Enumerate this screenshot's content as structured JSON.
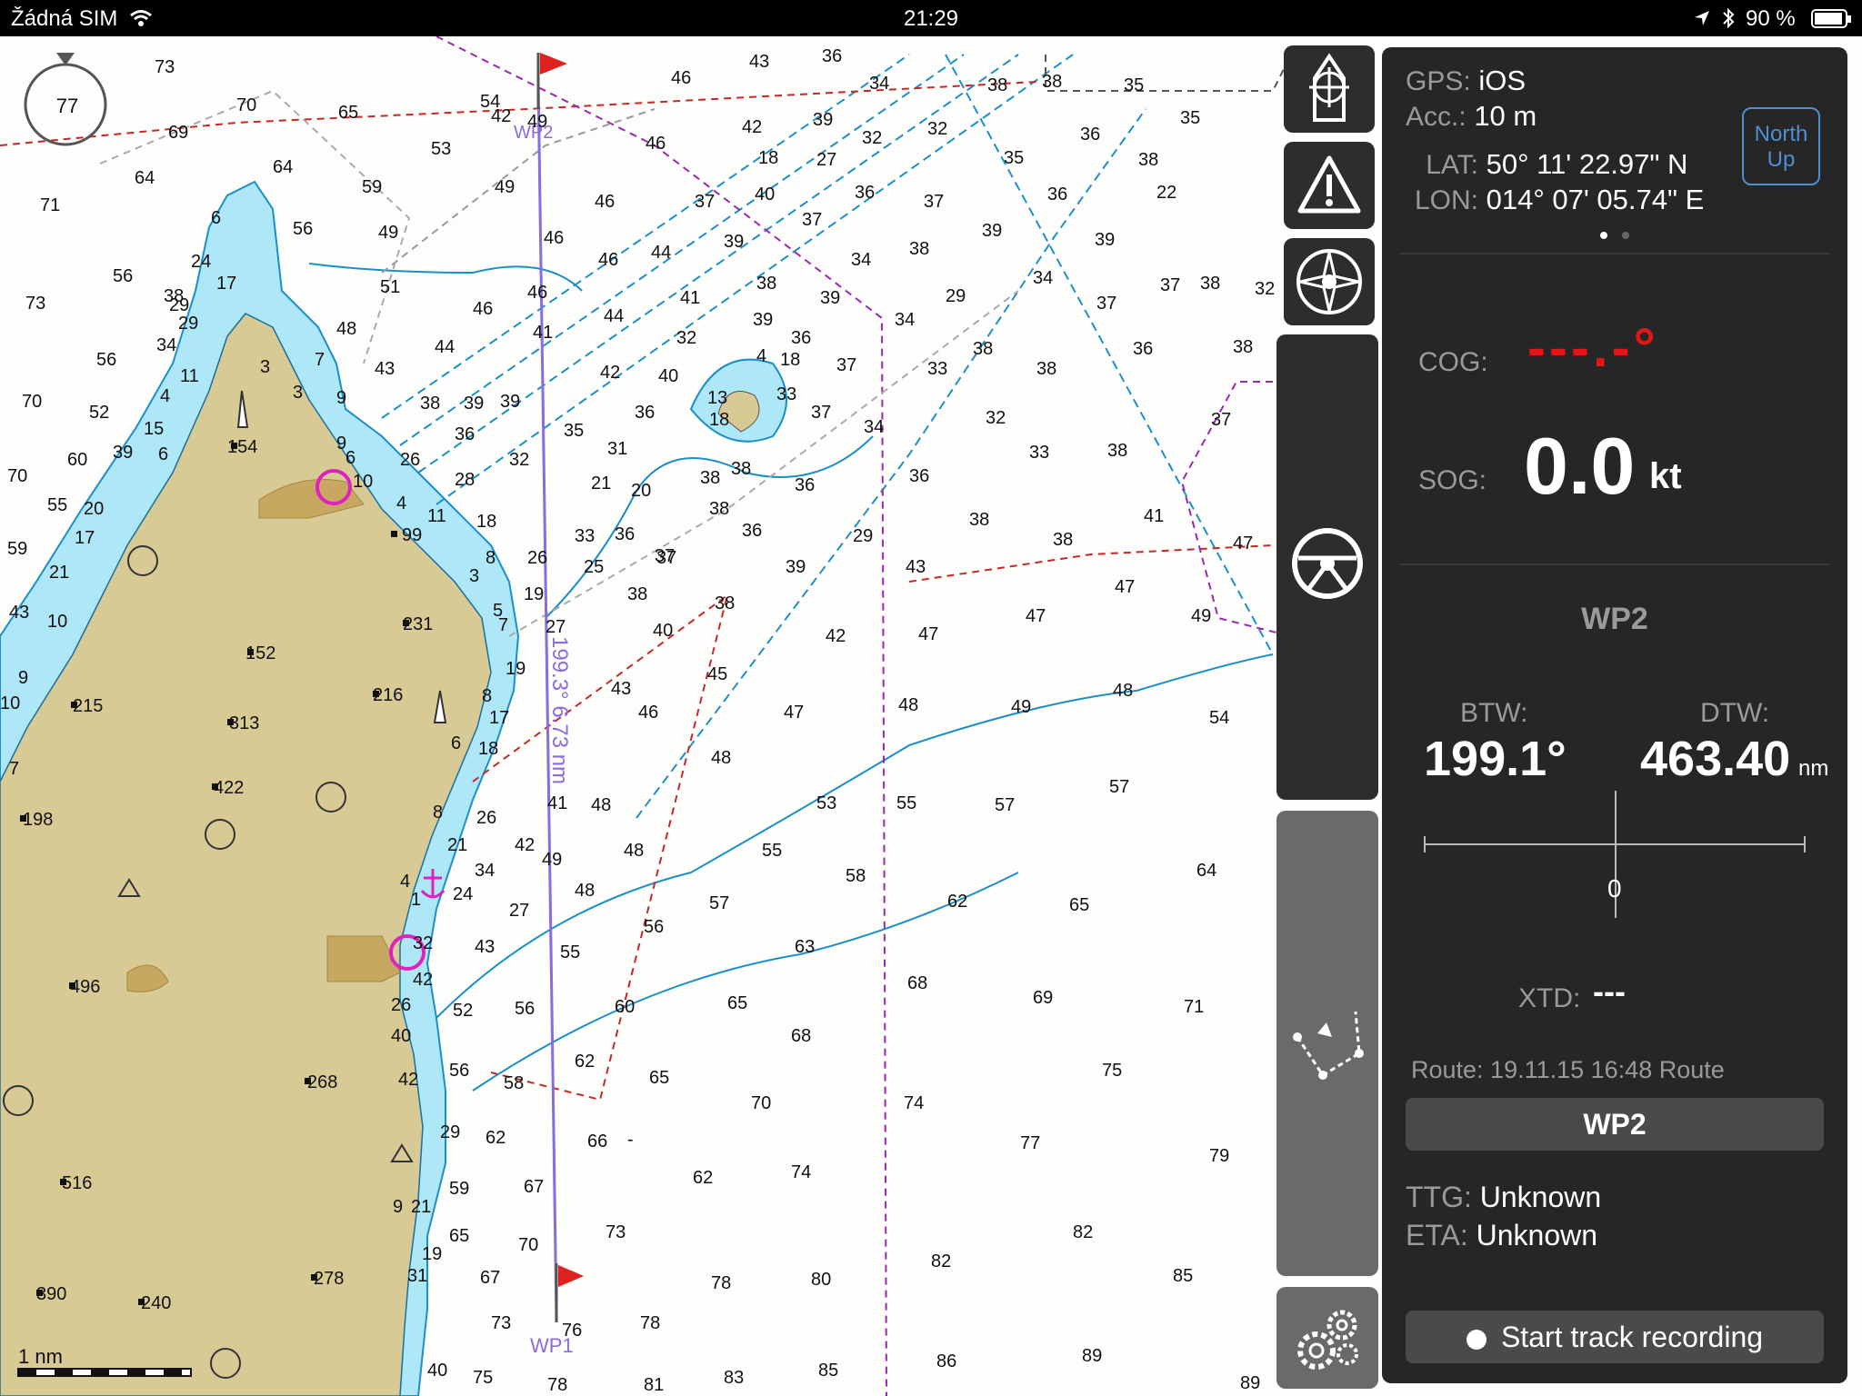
{
  "status_bar": {
    "carrier": "Žádná SIM",
    "time": "21:29",
    "battery": "90 %",
    "icons": [
      "wifi-icon",
      "location-arrow-icon",
      "bluetooth-icon",
      "battery-icon"
    ]
  },
  "chart": {
    "compass_value": "77",
    "waypoint_top": "WP2",
    "waypoint_bottom": "WP1",
    "route_label": "199.3° 6.73 nm",
    "scale_label": "1 nm",
    "spot_heights": [
      "154",
      "99",
      "231",
      "152",
      "216",
      "215",
      "313",
      "422",
      "198",
      "496",
      "268",
      "516",
      "390",
      "240",
      "278"
    ],
    "colors": {
      "land": "#d8ca95",
      "shallow_water": "#aee7f7",
      "contour": "#1a8fc9",
      "route": "#8a6be0",
      "boundary_red": "#c62828",
      "boundary_magenta": "#9c27b0"
    }
  },
  "toolbar": {
    "icons": [
      "center-boat-icon",
      "warning-icon",
      "compass-rose-icon",
      "steering-wheel-icon",
      "route-plan-icon",
      "settings-gears-icon"
    ]
  },
  "panel": {
    "gps_label": "GPS:",
    "gps_value": "iOS",
    "acc_label": "Acc.:",
    "acc_value": "10 m",
    "lat_label": "LAT:",
    "lat_value": "50° 11' 22.97\" N",
    "lon_label": "LON:",
    "lon_value": "014° 07' 05.74\" E",
    "north_up": "North Up",
    "cog_label": "COG:",
    "cog_value": "---.-°",
    "sog_label": "SOG:",
    "sog_value": "0.0",
    "sog_unit": "kt",
    "waypoint_name": "WP2",
    "btw_label": "BTW:",
    "btw_value": "199.1°",
    "dtw_label": "DTW:",
    "dtw_value": "463.40",
    "dtw_unit": "nm",
    "xte_scale_zero": "0",
    "xtd_label": "XTD:",
    "xtd_value": "---",
    "route_text": "Route: 19.11.15 16:48 Route",
    "wp_button": "WP2",
    "ttg_label": "TTG:",
    "ttg_value": "Unknown",
    "eta_label": "ETA:",
    "eta_value": "Unknown",
    "track_button": "Start track recording"
  }
}
